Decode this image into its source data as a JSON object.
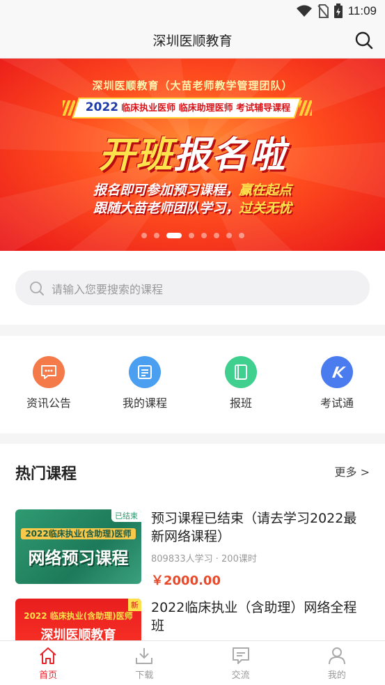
{
  "status_bar": {
    "time": "11:09",
    "icons": [
      "wifi-icon",
      "no-sim-icon",
      "battery-charging-icon"
    ]
  },
  "header": {
    "title": "深圳医顺教育",
    "search_icon": "search-icon"
  },
  "banner": {
    "org_line": "深圳医顺教育（大苗老师教学管理团队）",
    "year": "2022",
    "ribbon_text": "临床执业医师 临床助理医师 考试辅导课程",
    "headline_a": "开班",
    "headline_b": "报名啦",
    "line1_a": "报名即可参加预习课程，",
    "line1_b": "赢在起点",
    "line2_a": "跟随大苗老师团队学习，",
    "line2_b": "过关无忧",
    "slide_count": 8,
    "active_slide": 3
  },
  "search": {
    "placeholder": "请输入您要搜索的课程"
  },
  "menu": [
    {
      "label": "资讯公告",
      "icon": "chat-bubble-icon",
      "color": "#f47a4a"
    },
    {
      "label": "我的课程",
      "icon": "document-icon",
      "color": "#4a9ff0"
    },
    {
      "label": "报班",
      "icon": "book-icon",
      "color": "#3fcf8e"
    },
    {
      "label": "考试通",
      "icon": "exam-k-icon",
      "color": "#4a7cf0"
    }
  ],
  "courses": {
    "section_title": "热门课程",
    "more_label": "更多 >",
    "items": [
      {
        "title": "预习课程已结束（请去学习2022最新网络课程）",
        "meta": "809833人学习 · 200课时",
        "price": "￥2000.00",
        "thumb_tag": "已结束",
        "thumb_line1": "2022临床执业(含助理)医师",
        "thumb_line2": "网络预习课程"
      },
      {
        "title": "2022临床执业（含助理）网络全程班",
        "meta": "",
        "price": "",
        "thumb_tag": "新",
        "thumb_line1": "2022 临床执业(含助理)医师",
        "thumb_line2": "深圳医顺教育"
      }
    ]
  },
  "bottom_nav": [
    {
      "label": "首页",
      "icon": "home-icon",
      "active": true
    },
    {
      "label": "下载",
      "icon": "download-icon",
      "active": false
    },
    {
      "label": "交流",
      "icon": "message-icon",
      "active": false
    },
    {
      "label": "我的",
      "icon": "user-icon",
      "active": false
    }
  ],
  "colors": {
    "accent": "#e8232a",
    "price": "#e84a2c"
  }
}
